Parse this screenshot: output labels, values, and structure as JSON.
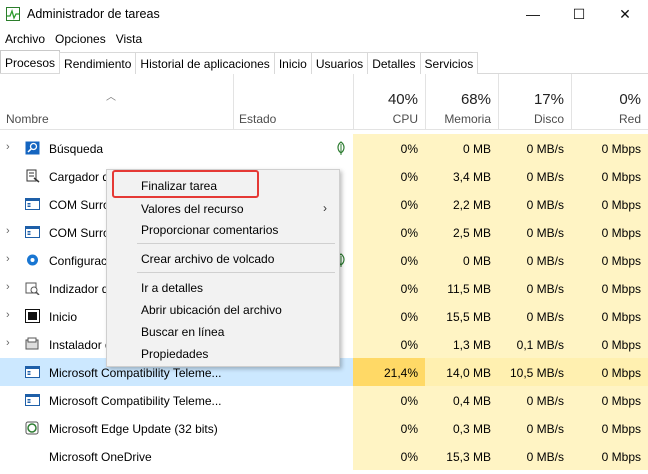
{
  "window": {
    "title": "Administrador de tareas",
    "minimize_glyph": "—",
    "maximize_glyph": "☐",
    "close_glyph": "✕"
  },
  "menu": [
    "Archivo",
    "Opciones",
    "Vista"
  ],
  "tabs": [
    "Procesos",
    "Rendimiento",
    "Historial de aplicaciones",
    "Inicio",
    "Usuarios",
    "Detalles",
    "Servicios"
  ],
  "active_tab": "Procesos",
  "columns": {
    "name": "Nombre",
    "state": "Estado",
    "cpu": {
      "percent": "40%",
      "label": "CPU"
    },
    "memory": {
      "percent": "68%",
      "label": "Memoria"
    },
    "disk": {
      "percent": "17%",
      "label": "Disco"
    },
    "network": {
      "percent": "0%",
      "label": "Red"
    }
  },
  "processes": [
    {
      "name": "Búsqueda",
      "icon": "search-icon",
      "expandable": true,
      "leaf": true,
      "cpu": "0%",
      "mem": "0 MB",
      "disk": "0 MB/s",
      "net": "0 Mbps"
    },
    {
      "name": "Cargador d",
      "icon": "loader-icon",
      "expandable": false,
      "leaf": false,
      "cpu": "0%",
      "mem": "3,4 MB",
      "disk": "0 MB/s",
      "net": "0 Mbps"
    },
    {
      "name": "COM Surro",
      "icon": "window-icon",
      "expandable": false,
      "leaf": false,
      "cpu": "0%",
      "mem": "2,2 MB",
      "disk": "0 MB/s",
      "net": "0 Mbps"
    },
    {
      "name": "COM Surro",
      "icon": "window-icon",
      "expandable": true,
      "leaf": false,
      "cpu": "0%",
      "mem": "2,5 MB",
      "disk": "0 MB/s",
      "net": "0 Mbps"
    },
    {
      "name": "Configurac",
      "icon": "gear-icon",
      "expandable": true,
      "leaf": true,
      "cpu": "0%",
      "mem": "0 MB",
      "disk": "0 MB/s",
      "net": "0 Mbps"
    },
    {
      "name": "Indizador d",
      "icon": "indexer-icon",
      "expandable": true,
      "leaf": false,
      "cpu": "0%",
      "mem": "11,5 MB",
      "disk": "0 MB/s",
      "net": "0 Mbps"
    },
    {
      "name": "Inicio",
      "icon": "start-icon",
      "expandable": true,
      "leaf": false,
      "cpu": "0%",
      "mem": "15,5 MB",
      "disk": "0 MB/s",
      "net": "0 Mbps"
    },
    {
      "name": "Instalador d",
      "icon": "installer-icon",
      "expandable": true,
      "leaf": false,
      "cpu": "0%",
      "mem": "1,3 MB",
      "disk": "0,1 MB/s",
      "net": "0 Mbps"
    },
    {
      "name": "Microsoft Compatibility Teleme...",
      "icon": "window-icon",
      "expandable": false,
      "leaf": false,
      "selected": true,
      "cpu": "21,4%",
      "mem": "14,0 MB",
      "disk": "10,5 MB/s",
      "net": "0 Mbps"
    },
    {
      "name": "Microsoft Compatibility Teleme...",
      "icon": "window-icon",
      "expandable": false,
      "leaf": false,
      "cpu": "0%",
      "mem": "0,4 MB",
      "disk": "0 MB/s",
      "net": "0 Mbps"
    },
    {
      "name": "Microsoft Edge Update (32 bits)",
      "icon": "edge-update-icon",
      "expandable": false,
      "leaf": false,
      "cpu": "0%",
      "mem": "0,3 MB",
      "disk": "0 MB/s",
      "net": "0 Mbps"
    },
    {
      "name": "Microsoft OneDrive",
      "icon": "",
      "expandable": false,
      "leaf": false,
      "cpu": "0%",
      "mem": "15,3 MB",
      "disk": "0 MB/s",
      "net": "0 Mbps"
    }
  ],
  "context_menu": {
    "end_task": "Finalizar tarea",
    "resource_values": "Valores del recurso",
    "feedback": "Proporcionar comentarios",
    "dump_file": "Crear archivo de volcado",
    "go_details": "Ir a detalles",
    "open_location": "Abrir ubicación del archivo",
    "search_online": "Buscar en línea",
    "properties": "Propiedades",
    "submenu_glyph": "›"
  },
  "colors": {
    "selection": "#cce8ff",
    "usage_light": "#fff4c4",
    "usage_strong": "#ffd966",
    "highlight_border": "#e53935"
  }
}
